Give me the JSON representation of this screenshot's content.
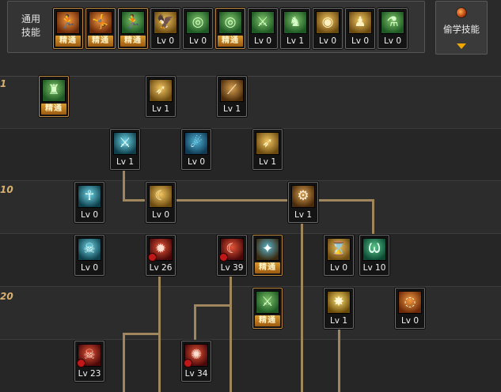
{
  "header": {
    "common_label_line1": "通用",
    "common_label_line2": "技能",
    "steal_label": "偷学技能"
  },
  "level_markers": [
    "1",
    "10",
    "20"
  ],
  "common_skills": [
    {
      "name": "common-skill-1",
      "level": "精通",
      "mastered": true,
      "theme": "t-orange",
      "glyph": "🏃"
    },
    {
      "name": "common-skill-2",
      "level": "精通",
      "mastered": true,
      "theme": "t-orange",
      "glyph": "🤸"
    },
    {
      "name": "common-skill-3",
      "level": "精通",
      "mastered": true,
      "theme": "t-green",
      "glyph": "🏃"
    },
    {
      "name": "common-skill-4",
      "level": "Lv 0",
      "mastered": false,
      "theme": "t-gold",
      "glyph": "🦅"
    },
    {
      "name": "common-skill-5",
      "level": "Lv 0",
      "mastered": false,
      "theme": "t-green",
      "glyph": "◎"
    },
    {
      "name": "common-skill-6",
      "level": "精通",
      "mastered": true,
      "theme": "t-green",
      "glyph": "◎"
    },
    {
      "name": "common-skill-7",
      "level": "Lv 0",
      "mastered": false,
      "theme": "t-green",
      "glyph": "⚔"
    },
    {
      "name": "common-skill-8",
      "level": "Lv 1",
      "mastered": false,
      "theme": "t-green",
      "glyph": "♞"
    },
    {
      "name": "common-skill-9",
      "level": "Lv 0",
      "mastered": false,
      "theme": "t-gold",
      "glyph": "◉"
    },
    {
      "name": "common-skill-10",
      "level": "Lv 0",
      "mastered": false,
      "theme": "t-gold",
      "glyph": "♟"
    },
    {
      "name": "common-skill-11",
      "level": "Lv 0",
      "mastered": false,
      "theme": "t-green",
      "glyph": "⚗"
    }
  ],
  "tree_skills": [
    {
      "name": "tree-skill-r1-a",
      "level": "精通",
      "mastered": true,
      "theme": "t-green",
      "glyph": "♜"
    },
    {
      "name": "tree-skill-r1-b",
      "level": "Lv 1",
      "mastered": false,
      "theme": "t-gold",
      "glyph": "➶"
    },
    {
      "name": "tree-skill-r1-c",
      "level": "Lv 1",
      "mastered": false,
      "theme": "t-brown",
      "glyph": "⟋"
    },
    {
      "name": "tree-skill-r2-a",
      "level": "Lv 1",
      "mastered": false,
      "theme": "t-cyan",
      "glyph": "⚔"
    },
    {
      "name": "tree-skill-r2-b",
      "level": "Lv 0",
      "mastered": false,
      "theme": "t-blue",
      "glyph": "☄"
    },
    {
      "name": "tree-skill-r2-c",
      "level": "Lv 1",
      "mastered": false,
      "theme": "t-gold",
      "glyph": "➶"
    },
    {
      "name": "tree-skill-r3-a",
      "level": "Lv 0",
      "mastered": false,
      "theme": "t-cyan",
      "glyph": "☥"
    },
    {
      "name": "tree-skill-r3-b",
      "level": "Lv 0",
      "mastered": false,
      "theme": "t-gold",
      "glyph": "☾"
    },
    {
      "name": "tree-skill-r3-c",
      "level": "Lv 1",
      "mastered": false,
      "theme": "t-brown",
      "glyph": "⚙"
    },
    {
      "name": "tree-skill-r4-a",
      "level": "Lv 0",
      "mastered": false,
      "theme": "t-cyan",
      "glyph": "☠"
    },
    {
      "name": "tree-skill-r4-b",
      "level": "Lv 26",
      "mastered": false,
      "theme": "t-red",
      "glyph": "✹",
      "badge": true
    },
    {
      "name": "tree-skill-r4-c",
      "level": "Lv 39",
      "mastered": false,
      "theme": "t-red",
      "glyph": "☾",
      "badge": true
    },
    {
      "name": "tree-skill-r4-d",
      "level": "精通",
      "mastered": true,
      "theme": "t-mixed",
      "glyph": "✦"
    },
    {
      "name": "tree-skill-r4-e",
      "level": "Lv 0",
      "mastered": false,
      "theme": "t-gold",
      "glyph": "⌛"
    },
    {
      "name": "tree-skill-r4-f",
      "level": "Lv 10",
      "mastered": false,
      "theme": "t-teal",
      "glyph": "Ѡ"
    },
    {
      "name": "tree-skill-r5-a",
      "level": "精通",
      "mastered": true,
      "theme": "t-green",
      "glyph": "⚔"
    },
    {
      "name": "tree-skill-r5-b",
      "level": "Lv 1",
      "mastered": false,
      "theme": "t-yellow",
      "glyph": "✸"
    },
    {
      "name": "tree-skill-r5-c",
      "level": "Lv 0",
      "mastered": false,
      "theme": "t-orange",
      "glyph": "◌"
    },
    {
      "name": "tree-skill-r6-a",
      "level": "Lv 23",
      "mastered": false,
      "theme": "t-red",
      "glyph": "☠",
      "badge": true
    },
    {
      "name": "tree-skill-r6-b",
      "level": "Lv 34",
      "mastered": false,
      "theme": "t-red",
      "glyph": "✺",
      "badge": true
    }
  ]
}
